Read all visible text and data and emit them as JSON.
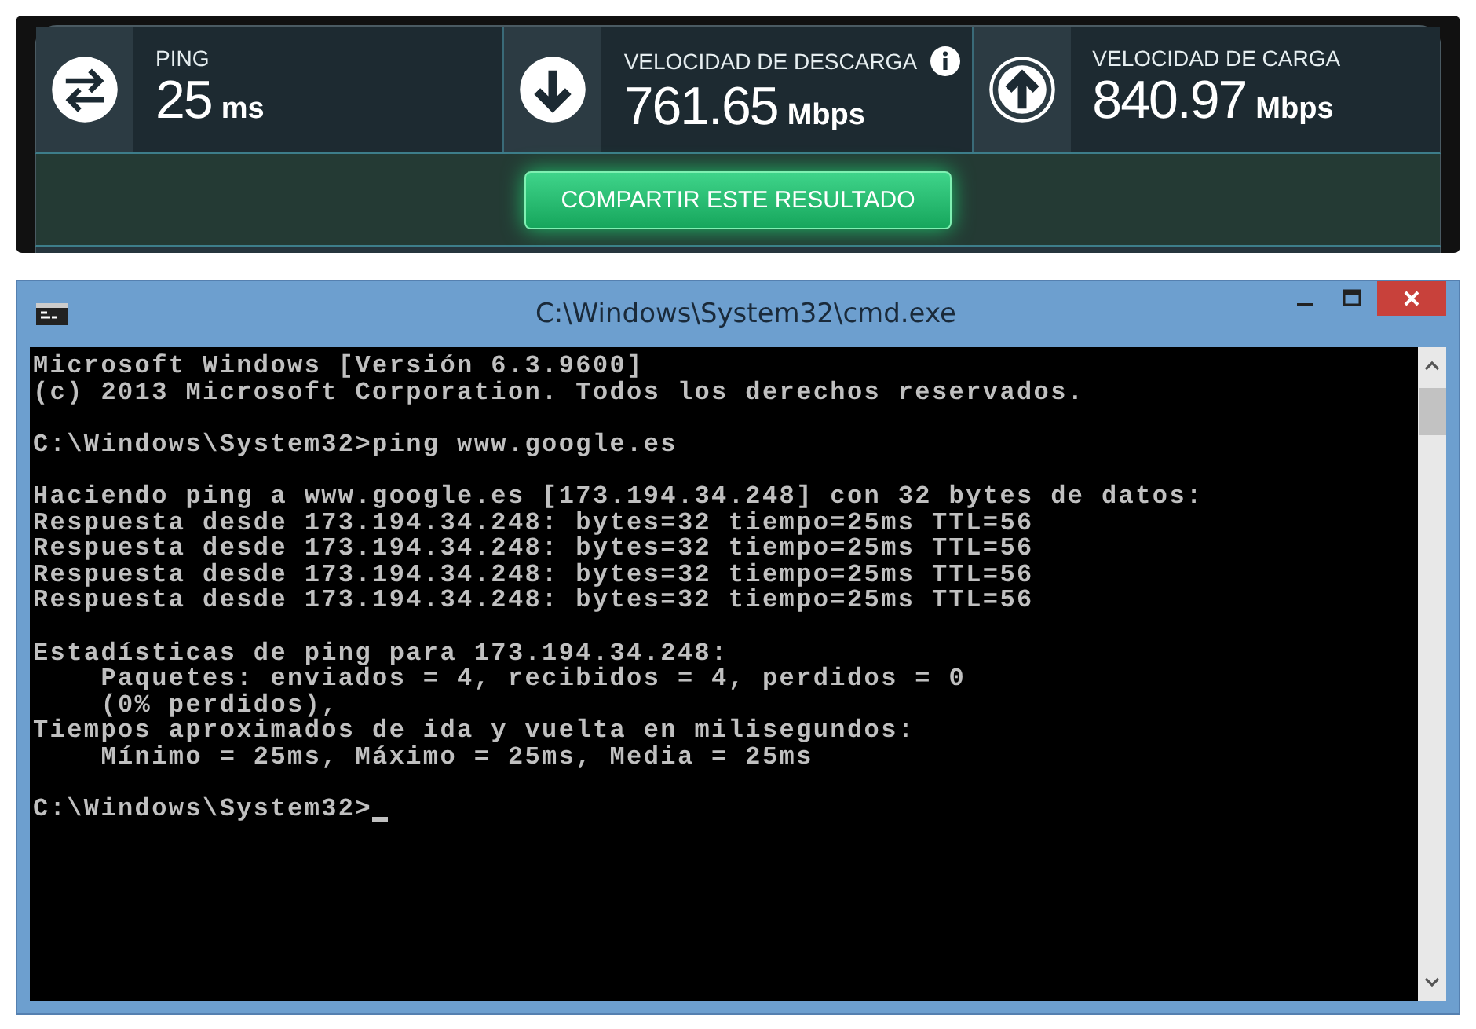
{
  "speedtest": {
    "metrics": [
      {
        "kind": "ping",
        "label": "PING",
        "value": "25",
        "unit": "ms",
        "info": false
      },
      {
        "kind": "download",
        "label": "VELOCIDAD DE DESCARGA",
        "value": "761.65",
        "unit": "Mbps",
        "info": true
      },
      {
        "kind": "upload",
        "label": "VELOCIDAD DE CARGA",
        "value": "840.97",
        "unit": "Mbps",
        "info": false
      }
    ],
    "share_button": "COMPARTIR ESTE RESULTADO"
  },
  "console_window": {
    "title": "C:\\Windows\\System32\\cmd.exe",
    "blocks": [
      [
        "Microsoft Windows [Versión 6.3.9600]",
        "(c) 2013 Microsoft Corporation. Todos los derechos reservados."
      ],
      [
        "C:\\Windows\\System32>ping www.google.es"
      ],
      [
        "Haciendo ping a www.google.es [173.194.34.248] con 32 bytes de datos:",
        "Respuesta desde 173.194.34.248: bytes=32 tiempo=25ms TTL=56",
        "Respuesta desde 173.194.34.248: bytes=32 tiempo=25ms TTL=56",
        "Respuesta desde 173.194.34.248: bytes=32 tiempo=25ms TTL=56",
        "Respuesta desde 173.194.34.248: bytes=32 tiempo=25ms TTL=56"
      ],
      [
        "Estadísticas de ping para 173.194.34.248:",
        "    Paquetes: enviados = 4, recibidos = 4, perdidos = 0",
        "    (0% perdidos),",
        "Tiempos aproximados de ida y vuelta en milisegundos:",
        "    Mínimo = 25ms, Máximo = 25ms, Media = 25ms"
      ]
    ],
    "prompt": "C:\\Windows\\System32>"
  }
}
